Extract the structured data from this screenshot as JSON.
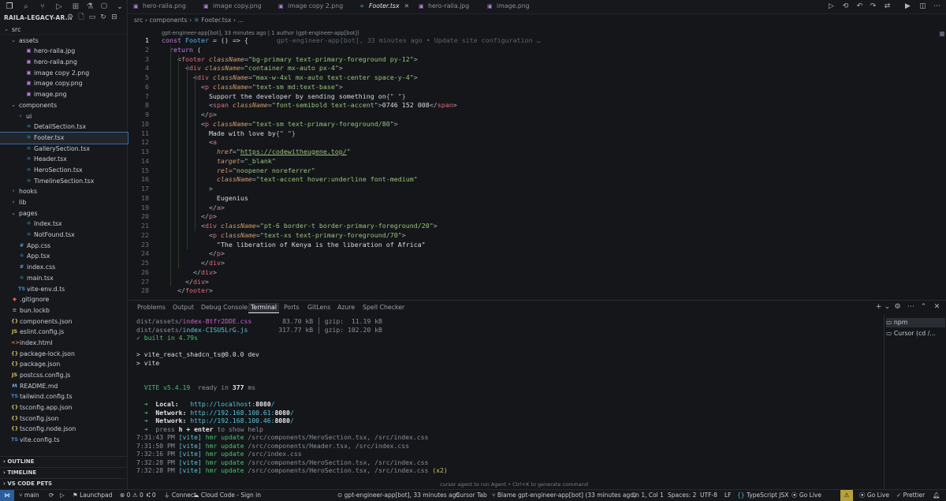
{
  "explorer": {
    "title": "RAILA-LEGACY-AR...",
    "tree": [
      {
        "label": "src",
        "depth": 0,
        "type": "folder",
        "open": true
      },
      {
        "label": "assets",
        "depth": 1,
        "type": "folder",
        "open": true
      },
      {
        "label": "hero-raila.jpg",
        "depth": 2,
        "type": "img"
      },
      {
        "label": "hero-raila.png",
        "depth": 2,
        "type": "img"
      },
      {
        "label": "image copy 2.png",
        "depth": 2,
        "type": "img"
      },
      {
        "label": "image copy.png",
        "depth": 2,
        "type": "img"
      },
      {
        "label": "image.png",
        "depth": 2,
        "type": "img"
      },
      {
        "label": "components",
        "depth": 1,
        "type": "folder",
        "open": true
      },
      {
        "label": "ui",
        "depth": 2,
        "type": "folder",
        "open": false
      },
      {
        "label": "DetailSection.tsx",
        "depth": 2,
        "type": "tsx"
      },
      {
        "label": "Footer.tsx",
        "depth": 2,
        "type": "tsx",
        "selected": true
      },
      {
        "label": "GallerySection.tsx",
        "depth": 2,
        "type": "tsx"
      },
      {
        "label": "Header.tsx",
        "depth": 2,
        "type": "tsx"
      },
      {
        "label": "HeroSection.tsx",
        "depth": 2,
        "type": "tsx"
      },
      {
        "label": "TimelineSection.tsx",
        "depth": 2,
        "type": "tsx"
      },
      {
        "label": "hooks",
        "depth": 1,
        "type": "folder",
        "open": false
      },
      {
        "label": "lib",
        "depth": 1,
        "type": "folder",
        "open": false
      },
      {
        "label": "pages",
        "depth": 1,
        "type": "folder",
        "open": true
      },
      {
        "label": "Index.tsx",
        "depth": 2,
        "type": "tsx"
      },
      {
        "label": "NotFound.tsx",
        "depth": 2,
        "type": "tsx"
      },
      {
        "label": "App.css",
        "depth": 1,
        "type": "css"
      },
      {
        "label": "App.tsx",
        "depth": 1,
        "type": "tsx"
      },
      {
        "label": "index.css",
        "depth": 1,
        "type": "css"
      },
      {
        "label": "main.tsx",
        "depth": 1,
        "type": "tsx"
      },
      {
        "label": "vite-env.d.ts",
        "depth": 1,
        "type": "ts"
      },
      {
        "label": ".gitignore",
        "depth": 0,
        "type": "git"
      },
      {
        "label": "bun.lockb",
        "depth": 0,
        "type": "gen"
      },
      {
        "label": "components.json",
        "depth": 0,
        "type": "json"
      },
      {
        "label": "eslint.config.js",
        "depth": 0,
        "type": "js"
      },
      {
        "label": "index.html",
        "depth": 0,
        "type": "html"
      },
      {
        "label": "package-lock.json",
        "depth": 0,
        "type": "json"
      },
      {
        "label": "package.json",
        "depth": 0,
        "type": "json"
      },
      {
        "label": "postcss.config.js",
        "depth": 0,
        "type": "js"
      },
      {
        "label": "README.md",
        "depth": 0,
        "type": "md"
      },
      {
        "label": "tailwind.config.ts",
        "depth": 0,
        "type": "ts"
      },
      {
        "label": "tsconfig.app.json",
        "depth": 0,
        "type": "json"
      },
      {
        "label": "tsconfig.json",
        "depth": 0,
        "type": "json"
      },
      {
        "label": "tsconfig.node.json",
        "depth": 0,
        "type": "json"
      },
      {
        "label": "vite.config.ts",
        "depth": 0,
        "type": "ts"
      }
    ],
    "outline": "OUTLINE",
    "timeline": "TIMELINE",
    "pets": "VS CODE PETS"
  },
  "tabs": [
    "hero-raila.png",
    "image copy.png",
    "image copy 2.png",
    "Footer.tsx",
    "hero-raila.jpg",
    "image.png"
  ],
  "breadcrumb": [
    "src",
    "components",
    "Footer.tsx",
    "..."
  ],
  "blame_header": "gpt-engineer-app[bot], 33 minutes ago | 1 author (gpt-engineer-app[bot])",
  "inline_blame": "gpt-engineer-app[bot], 33 minutes ago • Update site configuration …",
  "code": [
    [
      [
        "k",
        "const "
      ],
      [
        "f",
        "Footer"
      ],
      [
        "pl",
        " = () => {"
      ]
    ],
    [
      [
        "pl",
        "  "
      ],
      [
        "k",
        "return"
      ],
      [
        "pl",
        " ("
      ]
    ],
    [
      [
        "pl",
        "    "
      ],
      [
        "p",
        "<"
      ],
      [
        "t",
        "footer"
      ],
      [
        "pl",
        " "
      ],
      [
        "a",
        "className"
      ],
      [
        "p",
        "="
      ],
      [
        "s",
        "\"bg-primary text-primary-foreground py-12\""
      ],
      [
        "p",
        ">"
      ]
    ],
    [
      [
        "pl",
        "      "
      ],
      [
        "p",
        "<"
      ],
      [
        "t",
        "div"
      ],
      [
        "pl",
        " "
      ],
      [
        "a",
        "className"
      ],
      [
        "p",
        "="
      ],
      [
        "s",
        "\"container mx-auto px-4\""
      ],
      [
        "p",
        ">"
      ]
    ],
    [
      [
        "pl",
        "        "
      ],
      [
        "p",
        "<"
      ],
      [
        "t",
        "div"
      ],
      [
        "pl",
        " "
      ],
      [
        "a",
        "className"
      ],
      [
        "p",
        "="
      ],
      [
        "s",
        "\"max-w-4xl mx-auto text-center space-y-4\""
      ],
      [
        "p",
        ">"
      ]
    ],
    [
      [
        "pl",
        "          "
      ],
      [
        "p",
        "<"
      ],
      [
        "t",
        "p"
      ],
      [
        "pl",
        " "
      ],
      [
        "a",
        "className"
      ],
      [
        "p",
        "="
      ],
      [
        "s",
        "\"text-sm md:text-base\""
      ],
      [
        "p",
        ">"
      ]
    ],
    [
      [
        "pl",
        "            Support the developer by sending something on"
      ],
      [
        "p",
        "{"
      ],
      [
        "s",
        "\" \""
      ],
      [
        "p",
        "}"
      ]
    ],
    [
      [
        "pl",
        "            "
      ],
      [
        "p",
        "<"
      ],
      [
        "t",
        "span"
      ],
      [
        "pl",
        " "
      ],
      [
        "a",
        "className"
      ],
      [
        "p",
        "="
      ],
      [
        "s",
        "\"font-semibold text-accent\""
      ],
      [
        "p",
        ">"
      ],
      [
        "pl",
        "0746 152 008"
      ],
      [
        "p",
        "</"
      ],
      [
        "t",
        "span"
      ],
      [
        "p",
        ">"
      ]
    ],
    [
      [
        "pl",
        "          "
      ],
      [
        "p",
        "</"
      ],
      [
        "t",
        "p"
      ],
      [
        "p",
        ">"
      ]
    ],
    [
      [
        "pl",
        "          "
      ],
      [
        "p",
        "<"
      ],
      [
        "t",
        "p"
      ],
      [
        "pl",
        " "
      ],
      [
        "a",
        "className"
      ],
      [
        "p",
        "="
      ],
      [
        "s",
        "\"text-sm text-primary-foreground/80\""
      ],
      [
        "p",
        ">"
      ]
    ],
    [
      [
        "pl",
        "            Made with love by"
      ],
      [
        "p",
        "{"
      ],
      [
        "s",
        "\" \""
      ],
      [
        "p",
        "}"
      ]
    ],
    [
      [
        "pl",
        "            "
      ],
      [
        "p",
        "<"
      ],
      [
        "t",
        "a"
      ]
    ],
    [
      [
        "pl",
        "              "
      ],
      [
        "a",
        "href"
      ],
      [
        "p",
        "="
      ],
      [
        "s",
        "\""
      ],
      [
        "u",
        "https://codewitheugene.top/"
      ],
      [
        "s",
        "\""
      ]
    ],
    [
      [
        "pl",
        "              "
      ],
      [
        "a",
        "target"
      ],
      [
        "p",
        "="
      ],
      [
        "s",
        "\"_blank\""
      ]
    ],
    [
      [
        "pl",
        "              "
      ],
      [
        "a",
        "rel"
      ],
      [
        "p",
        "="
      ],
      [
        "s",
        "\"noopener noreferrer\""
      ]
    ],
    [
      [
        "pl",
        "              "
      ],
      [
        "a",
        "className"
      ],
      [
        "p",
        "="
      ],
      [
        "s",
        "\"text-accent hover:underline font-medium\""
      ]
    ],
    [
      [
        "pl",
        "            "
      ],
      [
        "p",
        ">"
      ]
    ],
    [
      [
        "pl",
        "              Eugenius"
      ]
    ],
    [
      [
        "pl",
        "            "
      ],
      [
        "p",
        "</"
      ],
      [
        "t",
        "a"
      ],
      [
        "p",
        ">"
      ]
    ],
    [
      [
        "pl",
        "          "
      ],
      [
        "p",
        "</"
      ],
      [
        "t",
        "p"
      ],
      [
        "p",
        ">"
      ]
    ],
    [
      [
        "pl",
        "          "
      ],
      [
        "p",
        "<"
      ],
      [
        "t",
        "div"
      ],
      [
        "pl",
        " "
      ],
      [
        "a",
        "className"
      ],
      [
        "p",
        "="
      ],
      [
        "s",
        "\"pt-6 border-t border-primary-foreground/20\""
      ],
      [
        "p",
        ">"
      ]
    ],
    [
      [
        "pl",
        "            "
      ],
      [
        "p",
        "<"
      ],
      [
        "t",
        "p"
      ],
      [
        "pl",
        " "
      ],
      [
        "a",
        "className"
      ],
      [
        "p",
        "="
      ],
      [
        "s",
        "\"text-xs text-primary-foreground/70\""
      ],
      [
        "p",
        ">"
      ]
    ],
    [
      [
        "pl",
        "              \"The liberation of Kenya is the liberation of Africa\""
      ]
    ],
    [
      [
        "pl",
        "            "
      ],
      [
        "p",
        "</"
      ],
      [
        "t",
        "p"
      ],
      [
        "p",
        ">"
      ]
    ],
    [
      [
        "pl",
        "          "
      ],
      [
        "p",
        "</"
      ],
      [
        "t",
        "div"
      ],
      [
        "p",
        ">"
      ]
    ],
    [
      [
        "pl",
        "        "
      ],
      [
        "p",
        "</"
      ],
      [
        "t",
        "div"
      ],
      [
        "p",
        ">"
      ]
    ],
    [
      [
        "pl",
        "      "
      ],
      [
        "p",
        "</"
      ],
      [
        "t",
        "div"
      ],
      [
        "p",
        ">"
      ]
    ],
    [
      [
        "pl",
        "    "
      ],
      [
        "p",
        "</"
      ],
      [
        "t",
        "footer"
      ],
      [
        "p",
        ">"
      ]
    ]
  ],
  "panel_tabs": [
    "Problems",
    "Output",
    "Debug Console",
    "Terminal",
    "Ports",
    "GitLens",
    "Azure",
    "Spell Checker"
  ],
  "active_panel_tab": "Terminal",
  "terminal": [
    [
      [
        "g",
        "dist/assets/"
      ],
      [
        "mg",
        "index-Btfr2DDE.css"
      ],
      [
        "g",
        "        83.70 kB │ gzip:  11.19 kB"
      ]
    ],
    [
      [
        "g",
        "dist/assets/"
      ],
      [
        "cy",
        "index-CISU5LrG.js"
      ],
      [
        "g",
        "        317.77 kB │ gzip: 102.20 kB"
      ]
    ],
    [
      [
        "gr",
        "✓ built in 4.79s"
      ]
    ],
    [
      [
        "pl",
        ""
      ]
    ],
    [
      [
        "pl",
        "> vite_react_shadcn_ts@0.0.0 dev"
      ]
    ],
    [
      [
        "pl",
        "> vite"
      ]
    ],
    [
      [
        "pl",
        ""
      ]
    ],
    [
      [
        "pl",
        ""
      ]
    ],
    [
      [
        "pl",
        "  "
      ],
      [
        "gr",
        "VITE v5.4.19"
      ],
      [
        "g",
        "  ready in "
      ],
      [
        "bw",
        "377"
      ],
      [
        "g",
        " ms"
      ]
    ],
    [
      [
        "pl",
        ""
      ]
    ],
    [
      [
        "pl",
        "  "
      ],
      [
        "gr",
        "➜"
      ],
      [
        "bw",
        "  Local:"
      ],
      [
        "pl",
        "   "
      ],
      [
        "cy",
        "http://localhost:"
      ],
      [
        "bw",
        "8080"
      ],
      [
        "cy",
        "/"
      ]
    ],
    [
      [
        "pl",
        "  "
      ],
      [
        "gr",
        "➜"
      ],
      [
        "bw",
        "  Network:"
      ],
      [
        "pl",
        " "
      ],
      [
        "cy",
        "http://192.168.100.61:"
      ],
      [
        "bw",
        "8080"
      ],
      [
        "cy",
        "/"
      ]
    ],
    [
      [
        "pl",
        "  "
      ],
      [
        "gr",
        "➜"
      ],
      [
        "bw",
        "  Network:"
      ],
      [
        "pl",
        " "
      ],
      [
        "cy",
        "http://192.168.100.46:"
      ],
      [
        "bw",
        "8080"
      ],
      [
        "cy",
        "/"
      ]
    ],
    [
      [
        "pl",
        "  "
      ],
      [
        "g",
        "➜  press "
      ],
      [
        "bw",
        "h + enter"
      ],
      [
        "g",
        " to show help"
      ]
    ],
    [
      [
        "g",
        "7:31:43 PM "
      ],
      [
        "cy",
        "[vite]"
      ],
      [
        "gr",
        " hmr update "
      ],
      [
        "g",
        "/src/components/HeroSection.tsx, /src/index.css"
      ]
    ],
    [
      [
        "g",
        "7:31:50 PM "
      ],
      [
        "cy",
        "[vite]"
      ],
      [
        "gr",
        " hmr update "
      ],
      [
        "g",
        "/src/components/Header.tsx, /src/index.css"
      ]
    ],
    [
      [
        "g",
        "7:32:16 PM "
      ],
      [
        "cy",
        "[vite]"
      ],
      [
        "gr",
        " hmr update "
      ],
      [
        "g",
        "/src/index.css"
      ]
    ],
    [
      [
        "g",
        "7:32:28 PM "
      ],
      [
        "cy",
        "[vite]"
      ],
      [
        "gr",
        " hmr update "
      ],
      [
        "g",
        "/src/components/HeroSection.tsx, /src/index.css"
      ]
    ],
    [
      [
        "g",
        "7:32:28 PM "
      ],
      [
        "cy",
        "[vite]"
      ],
      [
        "gr",
        " hmr update "
      ],
      [
        "g",
        "/src/components/HeroSection.tsx, /src/index.css "
      ],
      [
        "yl",
        "(x2)"
      ]
    ]
  ],
  "terminal_list": [
    "npm",
    "Cursor (cd /..."
  ],
  "hint": "cursor  agent to run Agent • Ctrl+K to generate command",
  "status": {
    "branch": "main",
    "launchpad": "Launchpad",
    "errors": "0",
    "warnings": "0",
    "ports": "0",
    "connect": "Connect",
    "cloud": "Cloud Code - Sign in",
    "blame": "gpt-engineer-app[bot], 33 minutes ago",
    "cursor_tab": "Cursor Tab",
    "blame2": "Blame gpt-engineer-app[bot] (33 minutes ago)",
    "position": "Ln 1, Col 1",
    "spaces": "Spaces: 2",
    "encoding": "UTF-8",
    "eol": "LF",
    "lang": "TypeScript JSX",
    "golive": "Go Live",
    "golive2": "Go Live",
    "prettier": "Prettier"
  }
}
